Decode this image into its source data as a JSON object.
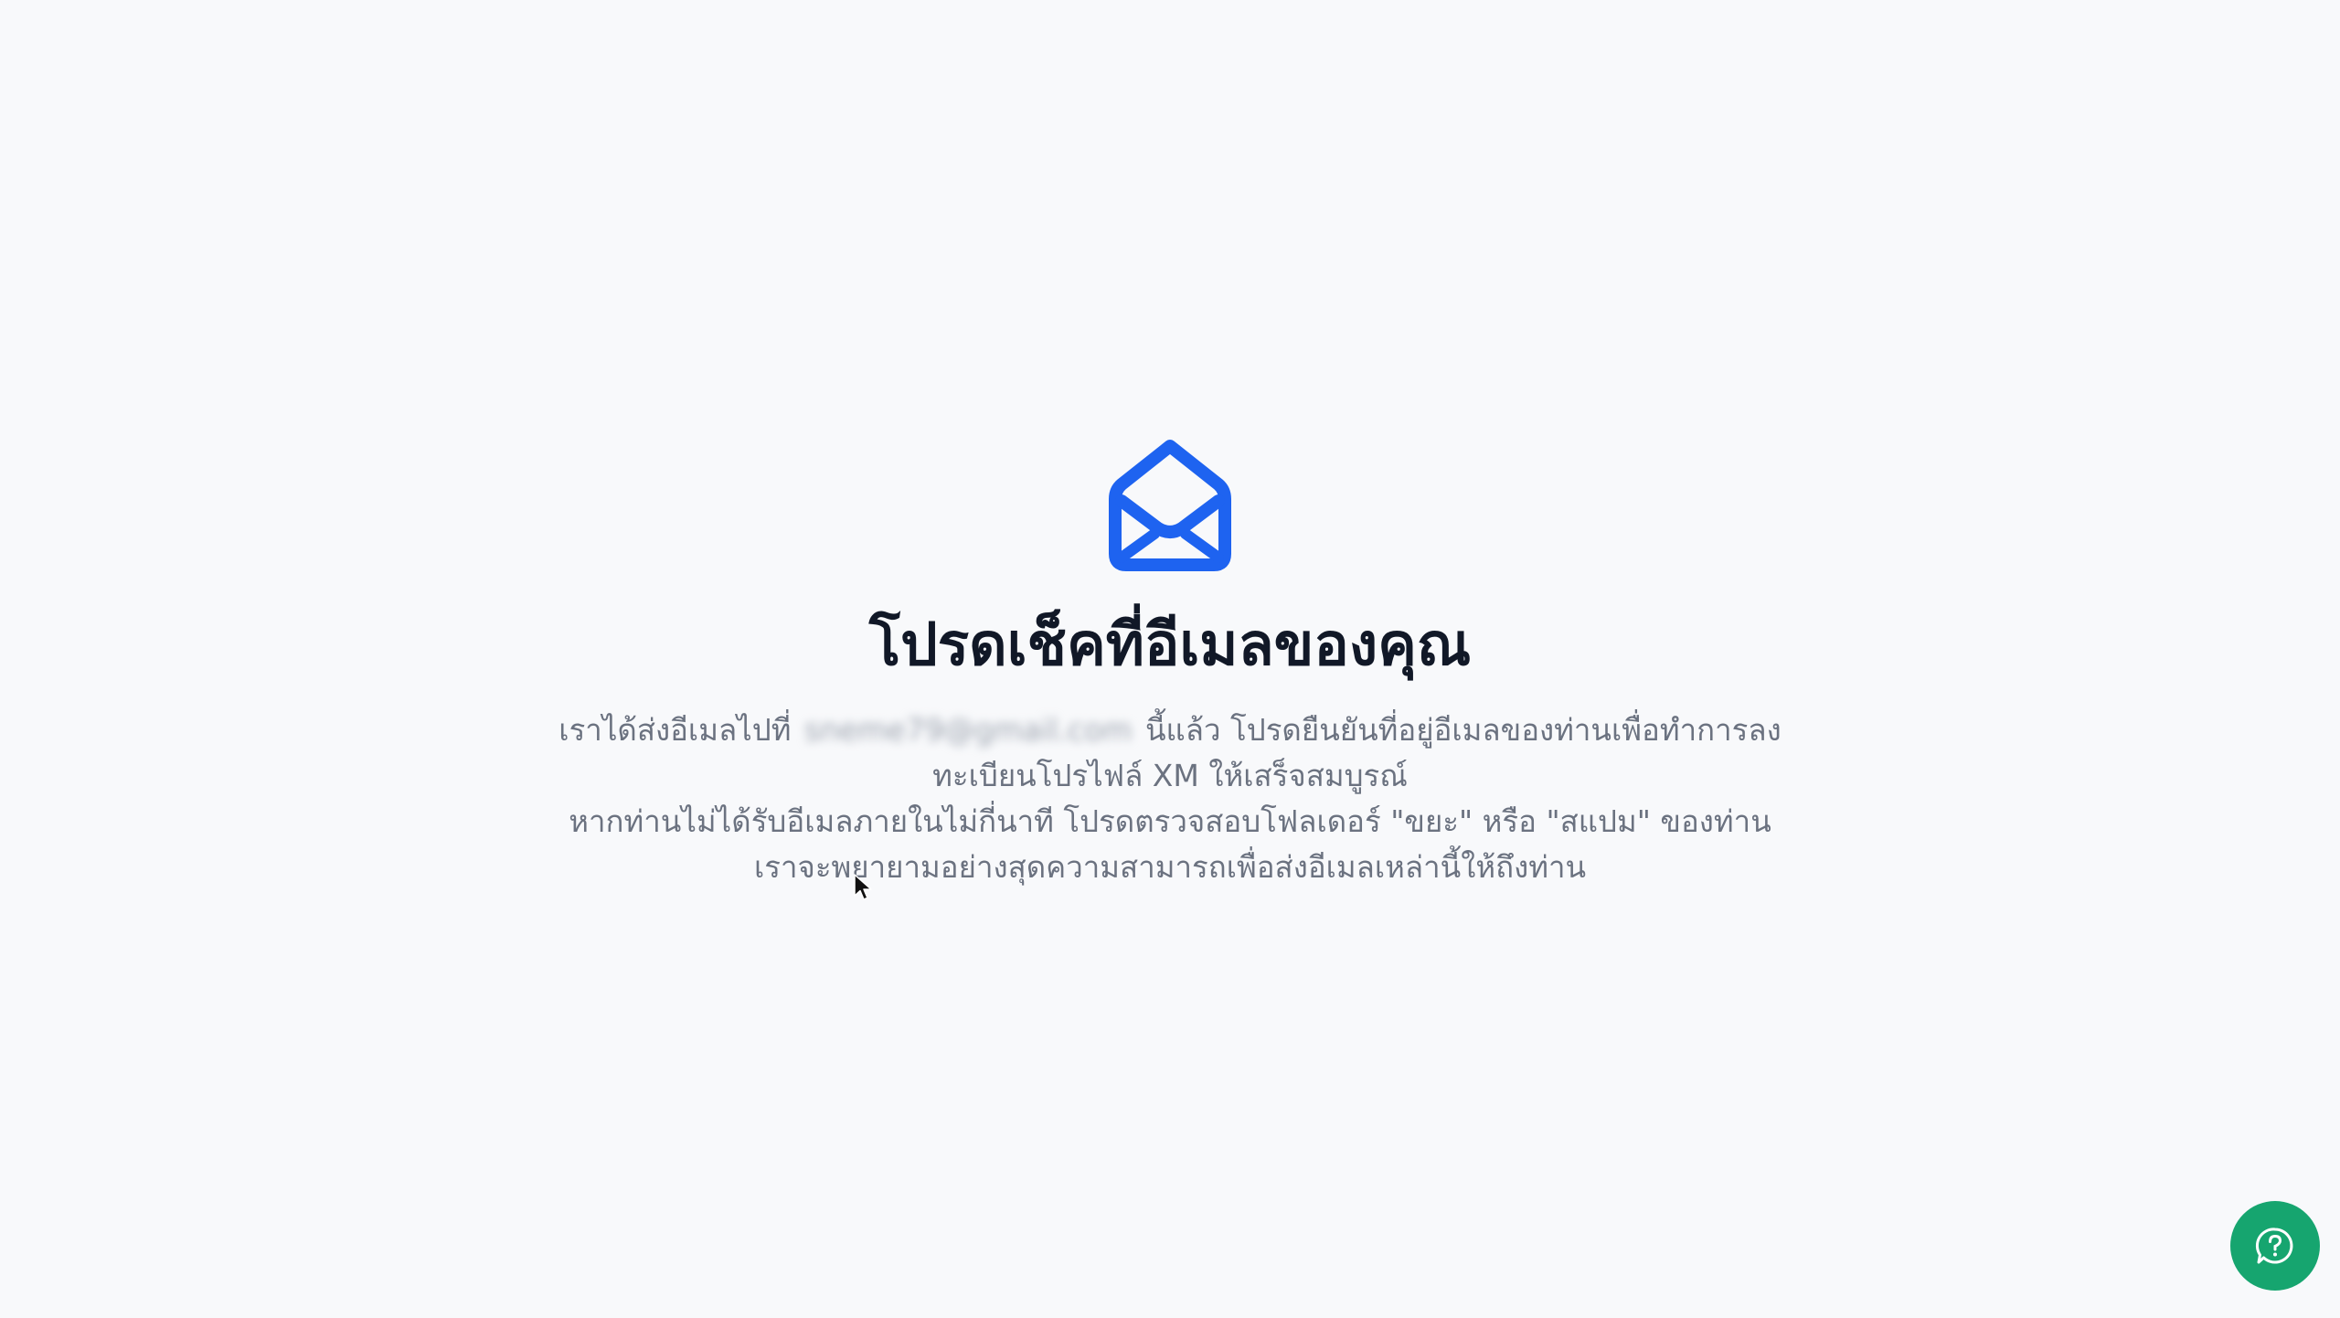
{
  "icons": {
    "mail": "envelope-open-icon",
    "help": "question-chat-icon",
    "cursor": "mouse-pointer"
  },
  "colors": {
    "background": "#f8f9fb",
    "icon_accent": "#1e63f0",
    "title": "#111827",
    "body": "#6b7280",
    "help_button": "#16a56f"
  },
  "main": {
    "title": "โปรดเช็คที่อีเมลของคุณ",
    "line1_before": "เราได้ส่งอีเมลไปที่",
    "email_redacted": "sneme79@gmail.com",
    "line1_after": "นี้แล้ว โปรดยืนยันที่อยู่อีเมลของท่านเพื่อทำการลง",
    "line2": "ทะเบียนโปรไฟล์ XM ให้เสร็จสมบูรณ์",
    "line3": "หากท่านไม่ได้รับอีเมลภายในไม่กี่นาที โปรดตรวจสอบโฟลเดอร์ \"ขยะ\" หรือ \"สแปม\" ของท่าน",
    "line4": "เราจะพยายามอย่างสุดความสามารถเพื่อส่งอีเมลเหล่านี้ให้ถึงท่าน"
  }
}
